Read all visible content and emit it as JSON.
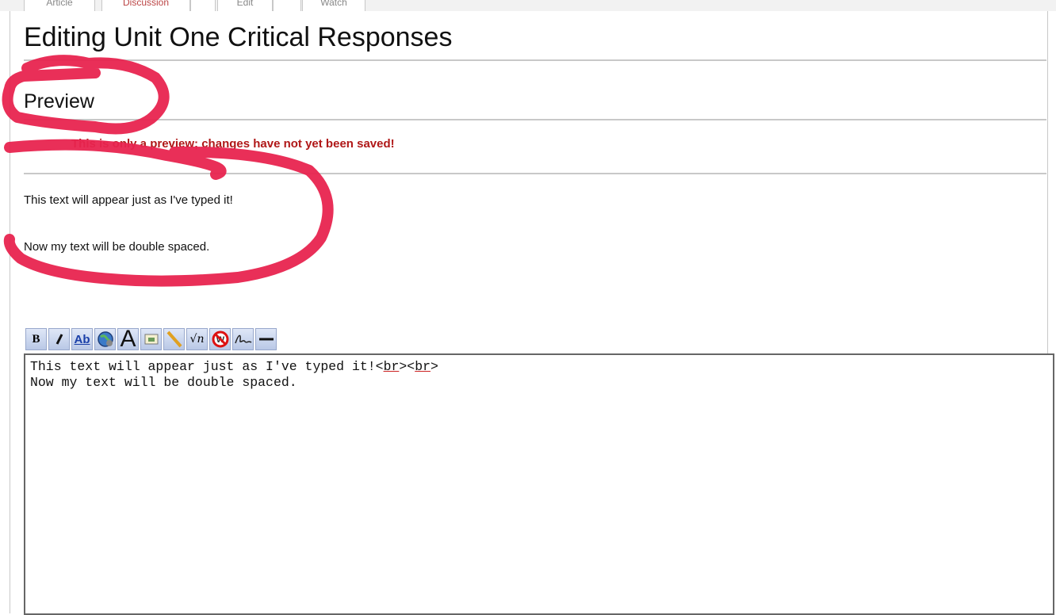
{
  "tabs": [
    {
      "label": "Article"
    },
    {
      "label": "Discussion"
    },
    {
      "label": ""
    },
    {
      "label": "Edit"
    },
    {
      "label": ""
    },
    {
      "label": "Watch"
    }
  ],
  "page": {
    "title": "Editing Unit One Critical Responses",
    "preview_heading": "Preview",
    "preview_note": "This is only a preview; changes have not yet been saved!",
    "preview_lines": [
      "This text will appear just as I've typed it!",
      "Now my text will be double spaced."
    ]
  },
  "toolbar": {
    "buttons": [
      {
        "name": "bold-button",
        "icon": "bold-icon",
        "label": "B"
      },
      {
        "name": "italic-button",
        "icon": "italic-icon",
        "label": "I"
      },
      {
        "name": "internal-link-button",
        "icon": "internal-link-icon",
        "label": "Ab"
      },
      {
        "name": "external-link-button",
        "icon": "globe-link-icon"
      },
      {
        "name": "headline-button",
        "icon": "headline-icon",
        "label": "A"
      },
      {
        "name": "embedded-image-button",
        "icon": "image-icon"
      },
      {
        "name": "media-file-button",
        "icon": "media-icon"
      },
      {
        "name": "math-formula-button",
        "icon": "sqrt-icon",
        "label": "√n"
      },
      {
        "name": "nowiki-button",
        "icon": "no-wiki-icon"
      },
      {
        "name": "signature-button",
        "icon": "signature-icon"
      },
      {
        "name": "horizontal-line-button",
        "icon": "horizontal-line-icon"
      }
    ]
  },
  "editor": {
    "line1_text": "This text will appear just as I've typed it!<",
    "line1_tag1": "br",
    "line1_mid": "><",
    "line1_tag2": "br",
    "line1_end": ">",
    "line2": "Now my text will be double spaced."
  },
  "colors": {
    "annotation": "#e8244f",
    "preview_note": "#b01818",
    "toolbar": "#c9d5ee"
  }
}
